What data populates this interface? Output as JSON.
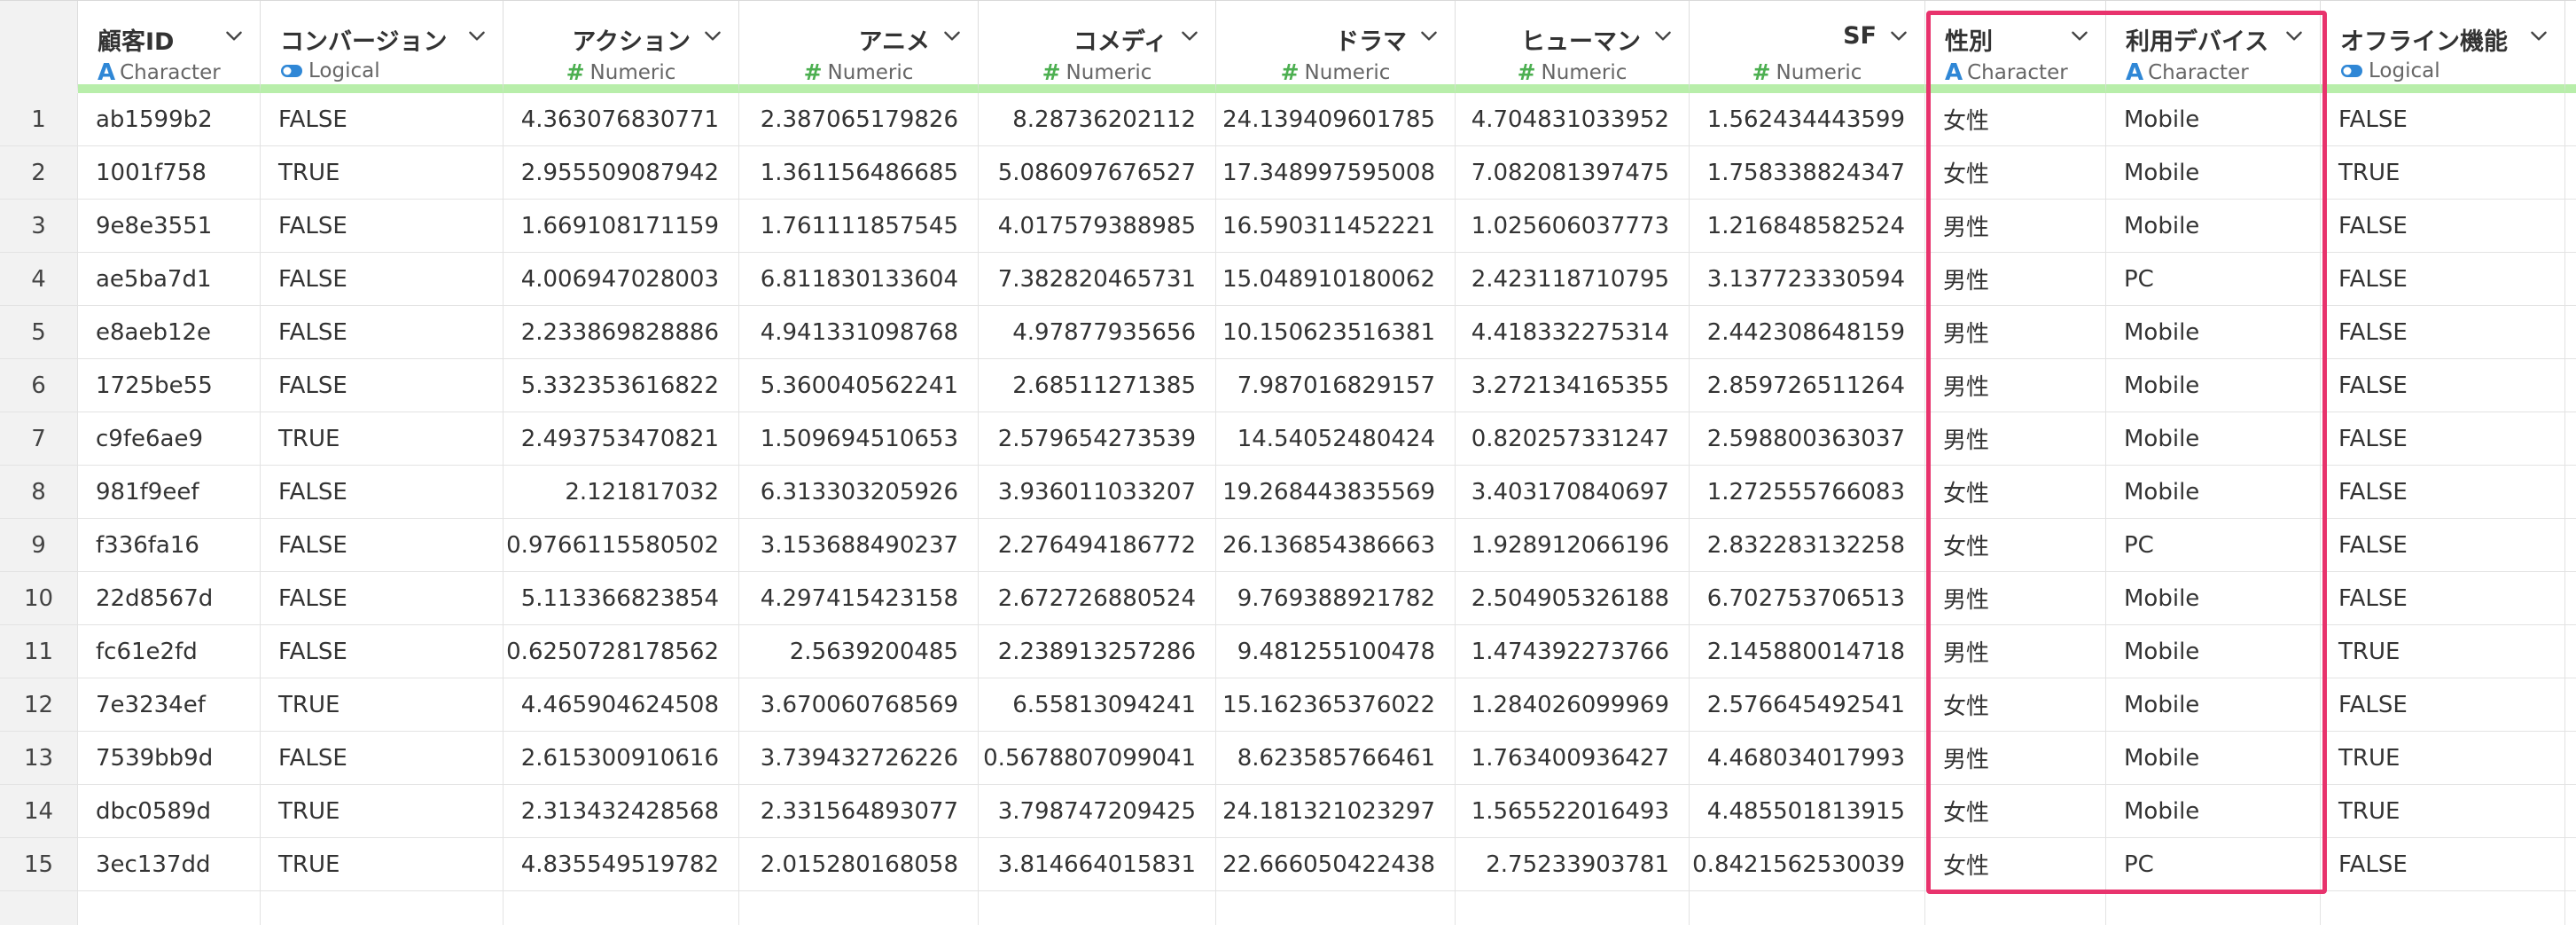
{
  "columns": [
    {
      "id": "customer-id",
      "name": "顧客ID",
      "type": "Character",
      "icon": "character-type-icon",
      "align": "left"
    },
    {
      "id": "conversion",
      "name": "コンバージョン",
      "type": "Logical",
      "icon": "logical-type-icon",
      "align": "left"
    },
    {
      "id": "action",
      "name": "アクション",
      "type": "Numeric",
      "icon": "numeric-type-icon",
      "align": "right"
    },
    {
      "id": "anime",
      "name": "アニメ",
      "type": "Numeric",
      "icon": "numeric-type-icon",
      "align": "right"
    },
    {
      "id": "comedy",
      "name": "コメディ",
      "type": "Numeric",
      "icon": "numeric-type-icon",
      "align": "right"
    },
    {
      "id": "drama",
      "name": "ドラマ",
      "type": "Numeric",
      "icon": "numeric-type-icon",
      "align": "right"
    },
    {
      "id": "human",
      "name": "ヒューマン",
      "type": "Numeric",
      "icon": "numeric-type-icon",
      "align": "right"
    },
    {
      "id": "sf",
      "name": "SF",
      "type": "Numeric",
      "icon": "numeric-type-icon",
      "align": "right"
    },
    {
      "id": "gender",
      "name": "性別",
      "type": "Character",
      "icon": "character-type-icon",
      "align": "left"
    },
    {
      "id": "device",
      "name": "利用デバイス",
      "type": "Character",
      "icon": "character-type-icon",
      "align": "left"
    },
    {
      "id": "offline",
      "name": "オフライン機能",
      "type": "Logical",
      "icon": "logical-type-icon",
      "align": "left"
    }
  ],
  "rows": [
    {
      "index": "1",
      "cells": [
        "ab1599b2",
        "FALSE",
        "4.363076830771",
        "2.387065179826",
        "8.28736202112",
        "24.139409601785",
        "4.704831033952",
        "1.562434443599",
        "女性",
        "Mobile",
        "FALSE"
      ]
    },
    {
      "index": "2",
      "cells": [
        "1001f758",
        "TRUE",
        "2.955509087942",
        "1.361156486685",
        "5.086097676527",
        "17.348997595008",
        "7.082081397475",
        "1.758338824347",
        "女性",
        "Mobile",
        "TRUE"
      ]
    },
    {
      "index": "3",
      "cells": [
        "9e8e3551",
        "FALSE",
        "1.669108171159",
        "1.761111857545",
        "4.017579388985",
        "16.590311452221",
        "1.025606037773",
        "1.216848582524",
        "男性",
        "Mobile",
        "FALSE"
      ]
    },
    {
      "index": "4",
      "cells": [
        "ae5ba7d1",
        "FALSE",
        "4.006947028003",
        "6.811830133604",
        "7.382820465731",
        "15.048910180062",
        "2.423118710795",
        "3.137723330594",
        "男性",
        "PC",
        "FALSE"
      ]
    },
    {
      "index": "5",
      "cells": [
        "e8aeb12e",
        "FALSE",
        "2.233869828886",
        "4.941331098768",
        "4.97877935656",
        "10.150623516381",
        "4.418332275314",
        "2.442308648159",
        "男性",
        "Mobile",
        "FALSE"
      ]
    },
    {
      "index": "6",
      "cells": [
        "1725be55",
        "FALSE",
        "5.332353616822",
        "5.360040562241",
        "2.68511271385",
        "7.987016829157",
        "3.272134165355",
        "2.859726511264",
        "男性",
        "Mobile",
        "FALSE"
      ]
    },
    {
      "index": "7",
      "cells": [
        "c9fe6ae9",
        "TRUE",
        "2.493753470821",
        "1.509694510653",
        "2.579654273539",
        "14.54052480424",
        "0.820257331247",
        "2.598800363037",
        "男性",
        "Mobile",
        "FALSE"
      ]
    },
    {
      "index": "8",
      "cells": [
        "981f9eef",
        "FALSE",
        "2.121817032",
        "6.313303205926",
        "3.936011033207",
        "19.268443835569",
        "3.403170840697",
        "1.272555766083",
        "女性",
        "Mobile",
        "FALSE"
      ]
    },
    {
      "index": "9",
      "cells": [
        "f336fa16",
        "FALSE",
        "0.9766115580502",
        "3.153688490237",
        "2.276494186772",
        "26.136854386663",
        "1.928912066196",
        "2.832283132258",
        "女性",
        "PC",
        "FALSE"
      ]
    },
    {
      "index": "10",
      "cells": [
        "22d8567d",
        "FALSE",
        "5.113366823854",
        "4.297415423158",
        "2.672726880524",
        "9.769388921782",
        "2.504905326188",
        "6.702753706513",
        "男性",
        "Mobile",
        "FALSE"
      ]
    },
    {
      "index": "11",
      "cells": [
        "fc61e2fd",
        "FALSE",
        "0.6250728178562",
        "2.5639200485",
        "2.238913257286",
        "9.481255100478",
        "1.474392273766",
        "2.145880014718",
        "男性",
        "Mobile",
        "TRUE"
      ]
    },
    {
      "index": "12",
      "cells": [
        "7e3234ef",
        "TRUE",
        "4.465904624508",
        "3.670060768569",
        "6.55813094241",
        "15.162365376022",
        "1.284026099969",
        "2.576645492541",
        "女性",
        "Mobile",
        "FALSE"
      ]
    },
    {
      "index": "13",
      "cells": [
        "7539bb9d",
        "FALSE",
        "2.615300910616",
        "3.739432726226",
        "0.5678807099041",
        "8.623585766461",
        "1.763400936427",
        "4.468034017993",
        "男性",
        "Mobile",
        "TRUE"
      ]
    },
    {
      "index": "14",
      "cells": [
        "dbc0589d",
        "TRUE",
        "2.313432428568",
        "2.331564893077",
        "3.798747209425",
        "24.181321023297",
        "1.565522016493",
        "4.485501813915",
        "女性",
        "Mobile",
        "TRUE"
      ]
    },
    {
      "index": "15",
      "cells": [
        "3ec137dd",
        "TRUE",
        "4.835549519782",
        "2.015280168058",
        "3.814664015831",
        "22.666050422438",
        "2.75233903781",
        "0.8421562530039",
        "女性",
        "PC",
        "FALSE"
      ]
    }
  ],
  "colors": {
    "header_underline": "#b8eeaa",
    "highlight_border": "#e8336d",
    "character_icon": "#2f87d6",
    "numeric_icon": "#4caf50",
    "logical_icon": "#2f87d6"
  }
}
